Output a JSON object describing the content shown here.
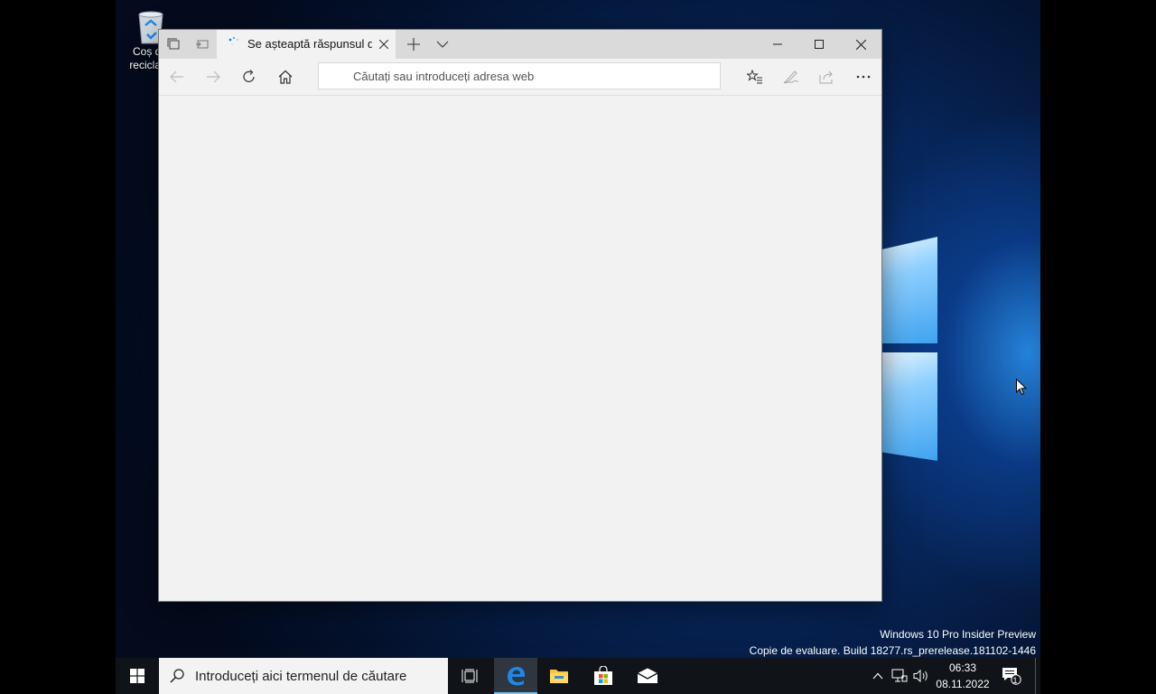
{
  "desktop": {
    "recycle_bin_label": "Coș de reciclare",
    "watermark_line1": "Windows 10 Pro Insider Preview",
    "watermark_line2": "Copie de evaluare. Build 18277.rs_prerelease.181102-1446"
  },
  "browser": {
    "tab_title": "Se așteaptă răspunsul d",
    "address_placeholder": "Căutați sau introduceți adresa web",
    "accent": "#0078d7"
  },
  "taskbar": {
    "search_placeholder": "Introduceți aici termenul de căutare",
    "time": "06:33",
    "date": "08.11.2022",
    "notification_count": "1"
  },
  "icons": [
    "recycle-bin-icon",
    "set-aside-tabs-icon",
    "tab-preview-icon",
    "loading-spinner-icon",
    "close-icon",
    "new-tab-icon",
    "chevron-down-icon",
    "minimize-icon",
    "maximize-icon",
    "back-icon",
    "forward-icon",
    "refresh-icon",
    "home-icon",
    "favorites-icon",
    "pen-icon",
    "share-icon",
    "more-icon",
    "windows-start-icon",
    "search-icon",
    "task-view-icon",
    "edge-icon",
    "file-explorer-icon",
    "store-icon",
    "mail-icon",
    "chevron-up-icon",
    "network-icon",
    "volume-icon",
    "action-center-icon"
  ]
}
